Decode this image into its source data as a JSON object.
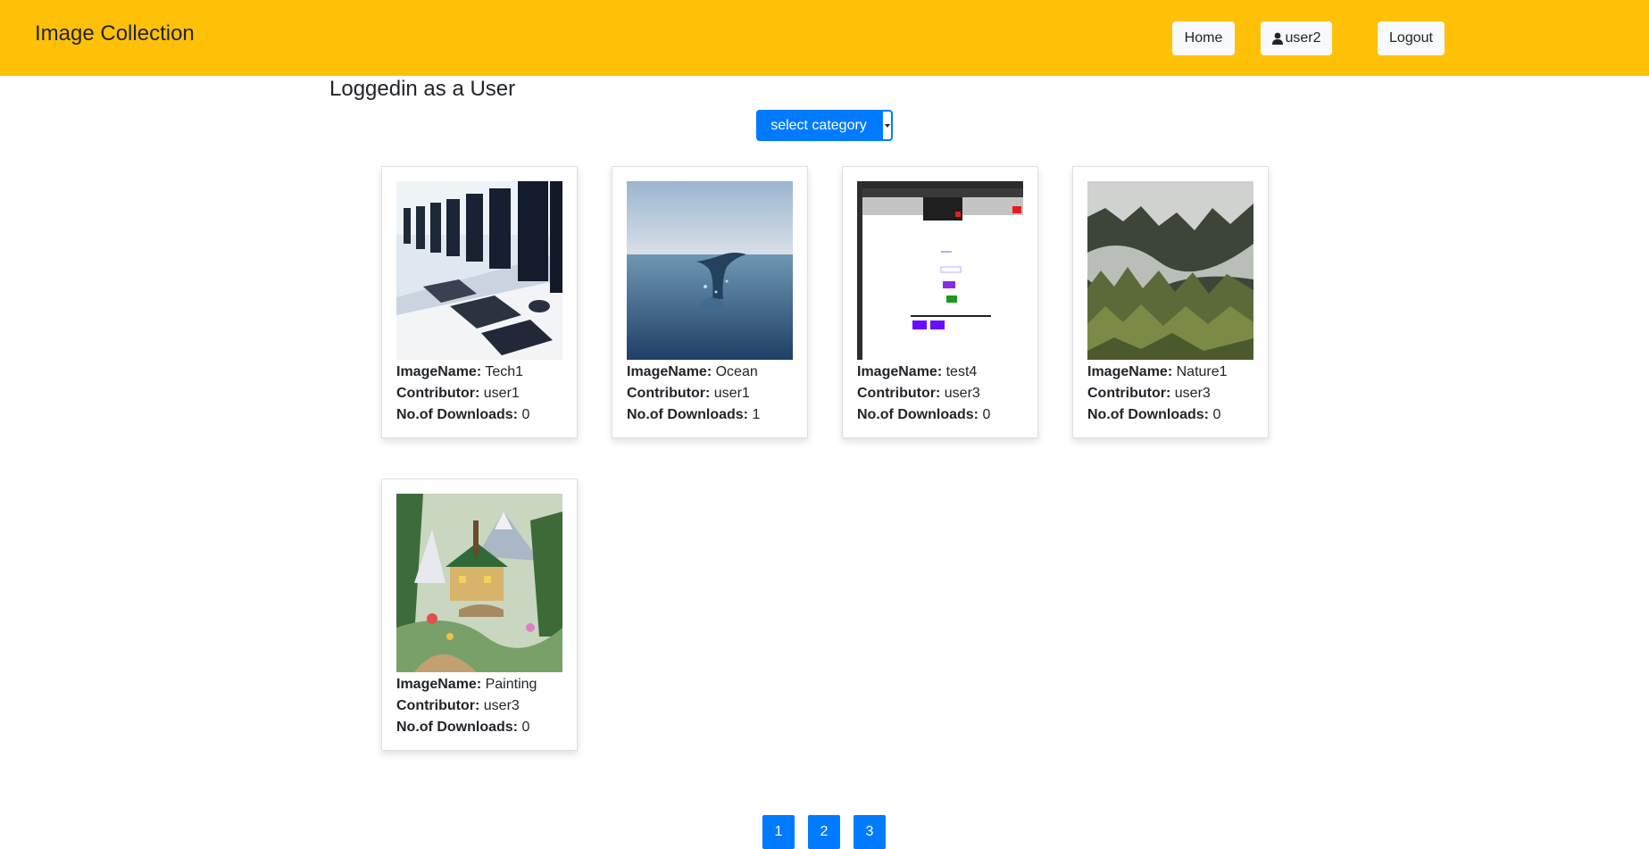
{
  "navbar": {
    "brand": "Image Collection",
    "home_label": "Home",
    "user_label": "user2",
    "logout_label": "Logout",
    "color": "#ffc107"
  },
  "status_text": "Loggedin as a User",
  "category_select": {
    "label": "select category",
    "color": "#007bff"
  },
  "field_labels": {
    "name": "ImageName:",
    "contributor": "Contributor:",
    "downloads": "No.of Downloads:"
  },
  "cards": [
    {
      "name": "Tech1",
      "contributor": "user1",
      "downloads": "0",
      "image": "computer-lab-photo"
    },
    {
      "name": "Ocean",
      "contributor": "user1",
      "downloads": "1",
      "image": "whale-tail-ocean-photo"
    },
    {
      "name": "test4",
      "contributor": "user3",
      "downloads": "0",
      "image": "app-screenshot"
    },
    {
      "name": "Nature1",
      "contributor": "user3",
      "downloads": "0",
      "image": "misty-forest-photo"
    },
    {
      "name": "Painting",
      "contributor": "user3",
      "downloads": "0",
      "image": "cottage-painting"
    }
  ],
  "pagination": [
    "1",
    "2",
    "3"
  ]
}
